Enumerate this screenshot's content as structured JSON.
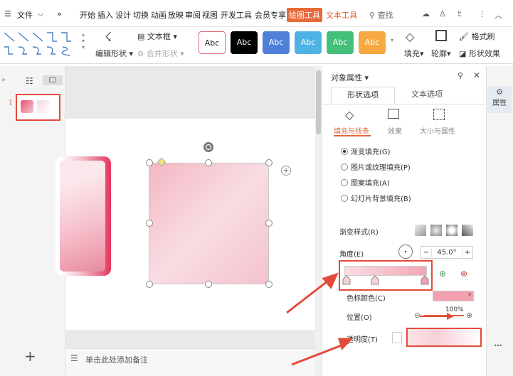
{
  "menubar": {
    "items": [
      "文件",
      "开始",
      "插入",
      "设计",
      "切换",
      "动画",
      "放映",
      "审阅",
      "视图",
      "开发工具",
      "会员专享",
      "绘图工具",
      "文本工具"
    ],
    "search": "查找"
  },
  "ribbon": {
    "edit_shape": "编辑形状",
    "textbox": "文本框",
    "merge_shape": "合并形状",
    "style_label": "Abc",
    "fill": "填充",
    "outline": "轮廓",
    "format_painter": "格式刷",
    "shape_effect": "形状效果",
    "style_colors": [
      "#ffffff",
      "#000000",
      "#4f81d9",
      "#4eb3e4",
      "#44c07a",
      "#f5a940"
    ]
  },
  "thumbs": {
    "slide_number": "1"
  },
  "notes": {
    "placeholder": "单击此处添加备注"
  },
  "panel": {
    "title": "对象属性",
    "tabs": [
      "形状选项",
      "文本选项"
    ],
    "subtabs": [
      "填充与线条",
      "效果",
      "大小与属性"
    ],
    "fill_options": [
      "渐变填充(G)",
      "图片或纹理填充(P)",
      "图案填充(A)",
      "幻灯片背景填充(B)"
    ],
    "gradient_style": "渐变样式(R)",
    "angle_label": "角度(E)",
    "angle_value": "45.0°",
    "stop_color": "色标颜色(C)",
    "position": "位置(O)",
    "position_value": "100%",
    "transparency": "透明度(T)"
  },
  "sidebar_right": {
    "properties": "属性"
  },
  "more": "•••"
}
